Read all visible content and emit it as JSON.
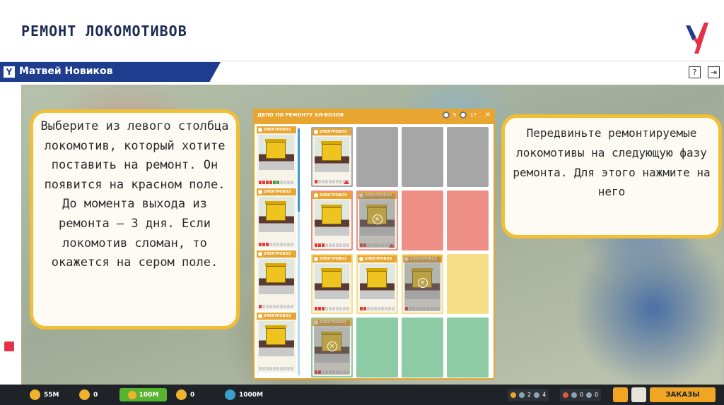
{
  "slide": {
    "title": "РЕМОНТ ЛОКОМОТИВОВ",
    "author_logo": "Y",
    "author": "Матвей Новиков",
    "brand_color": "#e2334b",
    "nav_color": "#1e3d8f"
  },
  "toolbar": {
    "help_icon": "?",
    "exit_icon": "exit-icon"
  },
  "instructions": {
    "left": "Выберите из левого столбца локомотив, который хотите поставить на ремонт. Он появится на красном поле. До момента выхода из ремонта – 3 дня. Если локомотив сломан, то окажется на сером поле.",
    "right": "Передвиньте ремонтируемые локомотивы на следующую фазу ремонта. Для этого нажмите на него"
  },
  "panel": {
    "title": "ДЕПО ПО РЕМОНТУ ЭЛ-ВОЗОВ",
    "stat_1": "9",
    "stat_2": "17",
    "close": "×",
    "card_label": "ЭЛЕКТРОВОЗ",
    "cell_colors": {
      "gray": "#a6a6a6",
      "red": "#ee8f86",
      "yellow": "#f4de87",
      "green": "#8ccba4"
    }
  },
  "bottom_bar": {
    "money": "55M",
    "res_2": "0",
    "green_value": "100M",
    "res_4": "0",
    "passengers": "1000M",
    "group_1_a": "2",
    "group_1_b": "4",
    "group_2_a": "0",
    "group_2_b": "0",
    "orders": "ЗАКАЗЫ"
  }
}
